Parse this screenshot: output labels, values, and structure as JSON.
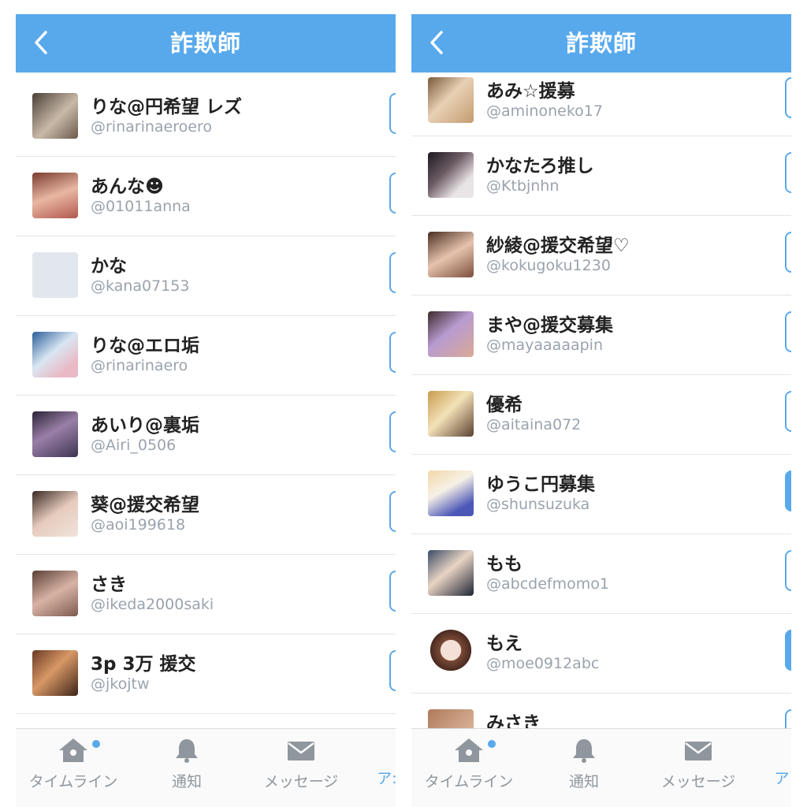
{
  "colors": {
    "accent": "#58a9ec",
    "separator": "#e3e5e8",
    "handle": "#9aa3ad"
  },
  "left": {
    "header": {
      "title": "詐欺師",
      "back_icon": "chevron-left-icon"
    },
    "users": [
      {
        "name": "りな@円希望 レズ",
        "handle": "@rinarinaeroero",
        "following": false
      },
      {
        "name": "あんな☻",
        "handle": "@01011anna",
        "following": false
      },
      {
        "name": "かな",
        "handle": "@kana07153",
        "following": false
      },
      {
        "name": "りな@エロ垢",
        "handle": "@rinarinaero",
        "following": false
      },
      {
        "name": "あいり@裏垢",
        "handle": "@Airi_0506",
        "following": false
      },
      {
        "name": "葵@援交希望",
        "handle": "@aoi199618",
        "following": false
      },
      {
        "name": "さき",
        "handle": "@ikeda2000saki",
        "following": false
      },
      {
        "name": "3p 3万 援交",
        "handle": "@jkojtw",
        "following": false
      }
    ],
    "tabbar": {
      "timeline": "タイムライン",
      "notifications": "通知",
      "messages": "メッセージ",
      "more": "ア:"
    }
  },
  "right": {
    "header": {
      "title": "詐欺師",
      "back_icon": "chevron-left-icon"
    },
    "users": [
      {
        "name": "あみ☆援募",
        "handle": "@aminoneko17",
        "following": false
      },
      {
        "name": "かなたろ推し",
        "handle": "@Ktbjnhn",
        "following": false
      },
      {
        "name": "紗綾@援交希望♡",
        "handle": "@kokugoku1230",
        "following": false
      },
      {
        "name": "まや@援交募集",
        "handle": "@mayaaaaapin",
        "following": false
      },
      {
        "name": "優希",
        "handle": "@aitaina072",
        "following": false
      },
      {
        "name": "ゆうこ円募集",
        "handle": "@shunsuzuka",
        "following": true
      },
      {
        "name": "もも",
        "handle": "@abcdefmomo1",
        "following": false
      },
      {
        "name": "もえ",
        "handle": "@moe0912abc",
        "following": true
      },
      {
        "name": "みさき",
        "handle": "",
        "following": false
      }
    ],
    "tabbar": {
      "timeline": "タイムライン",
      "notifications": "通知",
      "messages": "メッセージ",
      "more": "ア"
    }
  }
}
